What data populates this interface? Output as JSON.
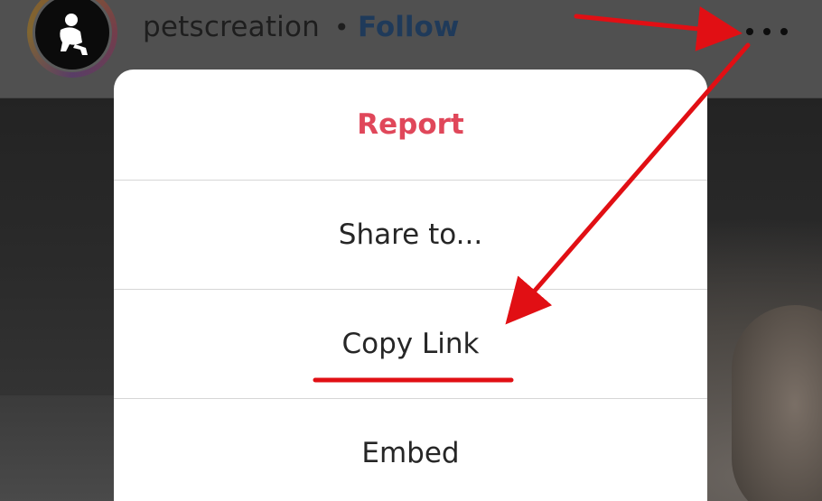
{
  "header": {
    "username": "petscreation",
    "separator": "•",
    "follow_label": "Follow",
    "more_icon": "more-horizontal-icon"
  },
  "menu": {
    "items": [
      {
        "label": "Report",
        "color": "#e0475a"
      },
      {
        "label": "Share to..."
      },
      {
        "label": "Copy Link"
      },
      {
        "label": "Embed"
      }
    ]
  },
  "annotations": {
    "arrow_color": "#e10f14",
    "underline_color": "#e10f14"
  }
}
